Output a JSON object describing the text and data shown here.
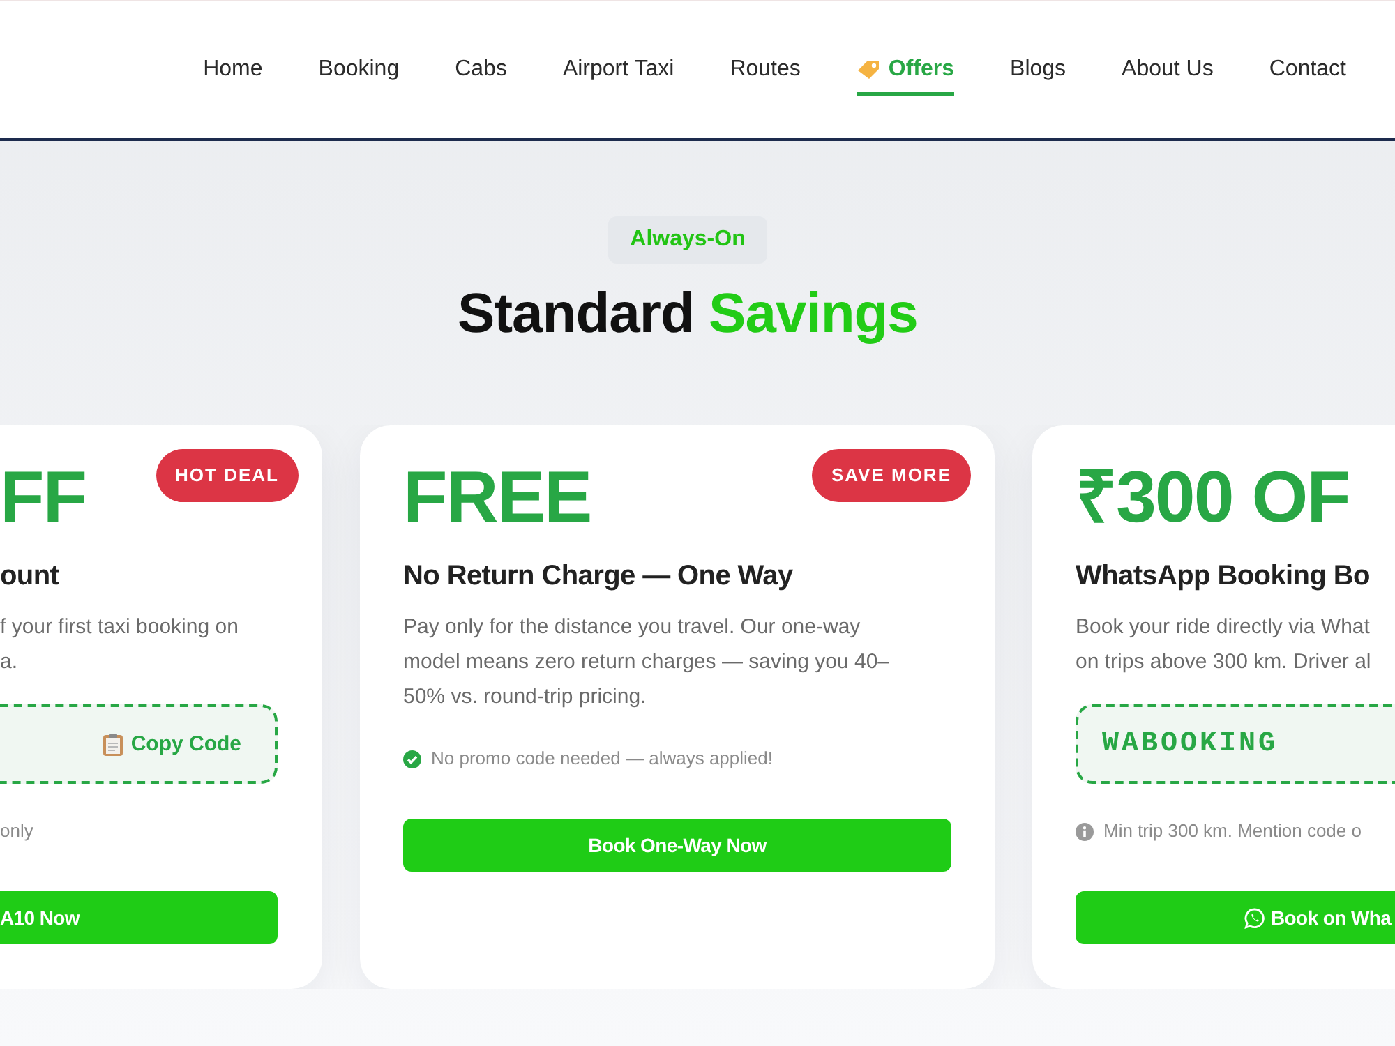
{
  "nav": {
    "items": [
      {
        "label": "Home",
        "selected": false,
        "kind": "page"
      },
      {
        "label": "Booking",
        "selected": false,
        "kind": "page"
      },
      {
        "label": "Cabs",
        "selected": false,
        "kind": "page"
      },
      {
        "label": "Airport Taxi",
        "selected": false,
        "kind": "page"
      },
      {
        "label": "Routes",
        "selected": false,
        "kind": "page"
      },
      {
        "label": "Offers",
        "selected": true,
        "kind": "promo"
      },
      {
        "label": "Blogs",
        "selected": false,
        "kind": "page"
      },
      {
        "label": "About Us",
        "selected": false,
        "kind": "page"
      },
      {
        "label": "Contact",
        "selected": false,
        "kind": "page"
      }
    ]
  },
  "section": {
    "badge": "Always-On",
    "heading": {
      "text": "Standard",
      "highlight": "Savings"
    }
  },
  "cards": [
    {
      "kind": "clipped-left",
      "badge": "HOT DEAL",
      "value": "FF",
      "title": "ount",
      "description": "f your first taxi booking on\na.",
      "promo": {
        "copy_label": "Copy Code"
      },
      "note": {
        "kind": "plain",
        "text": "only"
      },
      "button": {
        "kind": "plain",
        "label": "A10 Now"
      }
    },
    {
      "kind": "whole",
      "badge": "SAVE MORE",
      "value": "FREE",
      "title": "No Return Charge — One Way",
      "description": "Pay only for the distance you travel. Our one-way\nmodel means zero return charges — saving you 40–\n50% vs. round-trip pricing.",
      "note": {
        "kind": "benefit",
        "text": "No promo code needed — always applied!"
      },
      "button": {
        "kind": "plain",
        "label": "Book One-Way Now"
      }
    },
    {
      "kind": "clipped-right",
      "value": "₹300 OF",
      "title": "WhatsApp Booking Bo",
      "description": "Book your ride directly via What\non trips above 300 km. Driver al",
      "promo": {
        "code": "WABOOKING"
      },
      "note": {
        "kind": "condition",
        "text": "Min trip 300 km. Mention code o"
      },
      "button": {
        "kind": "chat",
        "label": "Book on Wha"
      }
    }
  ]
}
